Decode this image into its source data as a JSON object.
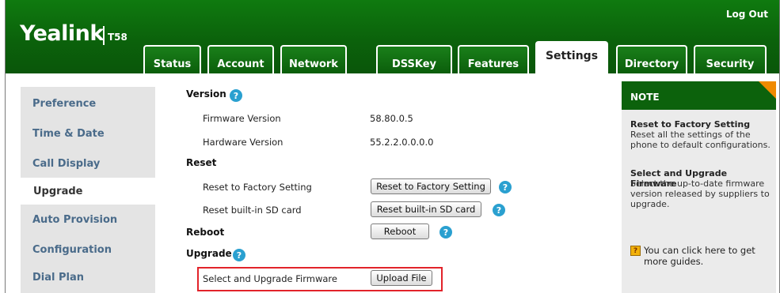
{
  "header": {
    "logo": "Yealink",
    "model": "T58",
    "logout": "Log Out"
  },
  "tabs": [
    {
      "label": "Status"
    },
    {
      "label": "Account"
    },
    {
      "label": "Network"
    },
    {
      "label": "DSSKey"
    },
    {
      "label": "Features"
    },
    {
      "label": "Settings",
      "active": true
    },
    {
      "label": "Directory"
    },
    {
      "label": "Security"
    }
  ],
  "sidebar": {
    "items": [
      {
        "label": "Preference"
      },
      {
        "label": "Time & Date"
      },
      {
        "label": "Call Display"
      },
      {
        "label": "Upgrade",
        "active": true
      },
      {
        "label": "Auto Provision"
      },
      {
        "label": "Configuration"
      },
      {
        "label": "Dial Plan"
      }
    ]
  },
  "main": {
    "version": {
      "title": "Version",
      "firmware_label": "Firmware Version",
      "firmware_value": "58.80.0.5",
      "hardware_label": "Hardware Version",
      "hardware_value": "55.2.2.0.0.0.0"
    },
    "reset": {
      "title": "Reset",
      "factory_label": "Reset to Factory Setting",
      "factory_button": "Reset to Factory Setting",
      "sd_label": "Reset built-in SD card",
      "sd_button": "Reset built-in SD card"
    },
    "reboot": {
      "title": "Reboot",
      "button": "Reboot"
    },
    "upgrade": {
      "title": "Upgrade",
      "firmware_label": "Select and Upgrade Firmware",
      "upload_button": "Upload File"
    },
    "help_glyph": "?"
  },
  "note": {
    "title": "NOTE",
    "reset_heading": "Reset to Factory Setting",
    "reset_text": "Reset all the settings of the phone to default configurations.",
    "upgrade_heading": "Select and Upgrade Firmware",
    "upgrade_text": "Select the up-to-date firmware version released by suppliers to upgrade.",
    "guide_text": "You can click here to get more guides."
  },
  "colors": {
    "header_green": "#0b620b",
    "help_blue": "#2aa0d0",
    "highlight_red": "#e2232a",
    "note_corner_orange": "#f08a00"
  }
}
